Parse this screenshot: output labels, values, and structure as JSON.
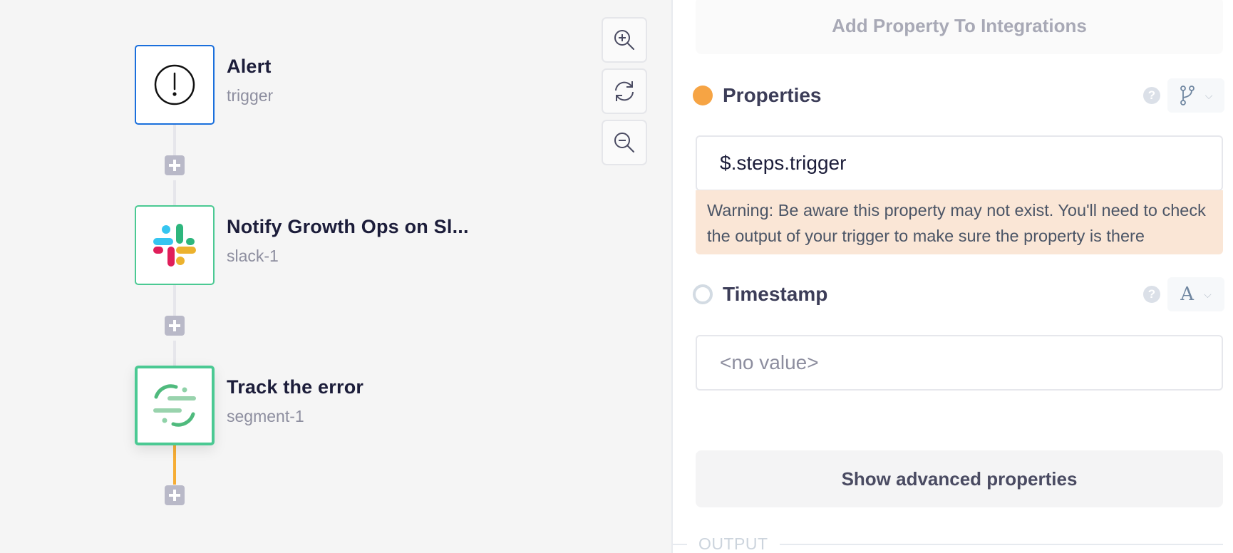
{
  "canvas": {
    "zoom_controls": [
      {
        "name": "zoom-in-button",
        "icon": "zoom-in-icon"
      },
      {
        "name": "reset-view-button",
        "icon": "refresh-icon"
      },
      {
        "name": "zoom-out-button",
        "icon": "zoom-out-icon"
      }
    ],
    "nodes": [
      {
        "title": "Alert",
        "subtitle": "trigger",
        "icon": "alert-circle-icon",
        "kind": "trigger"
      },
      {
        "title": "Notify Growth Ops on Sl...",
        "subtitle": "slack-1",
        "icon": "slack-logo-icon",
        "kind": "action"
      },
      {
        "title": "Track the error",
        "subtitle": "segment-1",
        "icon": "segment-logo-icon",
        "kind": "action",
        "selected": true
      }
    ],
    "add_step_icon": "plus-icon"
  },
  "panel": {
    "add_property_button": "Add Property To Integrations",
    "properties": [
      {
        "label": "Properties",
        "status": "filled",
        "status_color": "#f6a444",
        "help_icon": "?",
        "type_icon": "branch-icon",
        "value": "$.steps.trigger",
        "warning": "Warning: Be aware this property may not exist. You'll need to check the output of your trigger to make sure the property is there"
      },
      {
        "label": "Timestamp",
        "status": "empty",
        "help_icon": "?",
        "type_icon": "text-type-icon",
        "type_glyph": "A",
        "placeholder": "<no value>"
      }
    ],
    "advanced_button": "Show advanced properties",
    "output_label": "OUTPUT"
  },
  "colors": {
    "trigger_border": "#1a6fdc",
    "action_border": "#4bc993",
    "active_connector": "#f6ad35",
    "warning_bg": "#fae6d6"
  }
}
